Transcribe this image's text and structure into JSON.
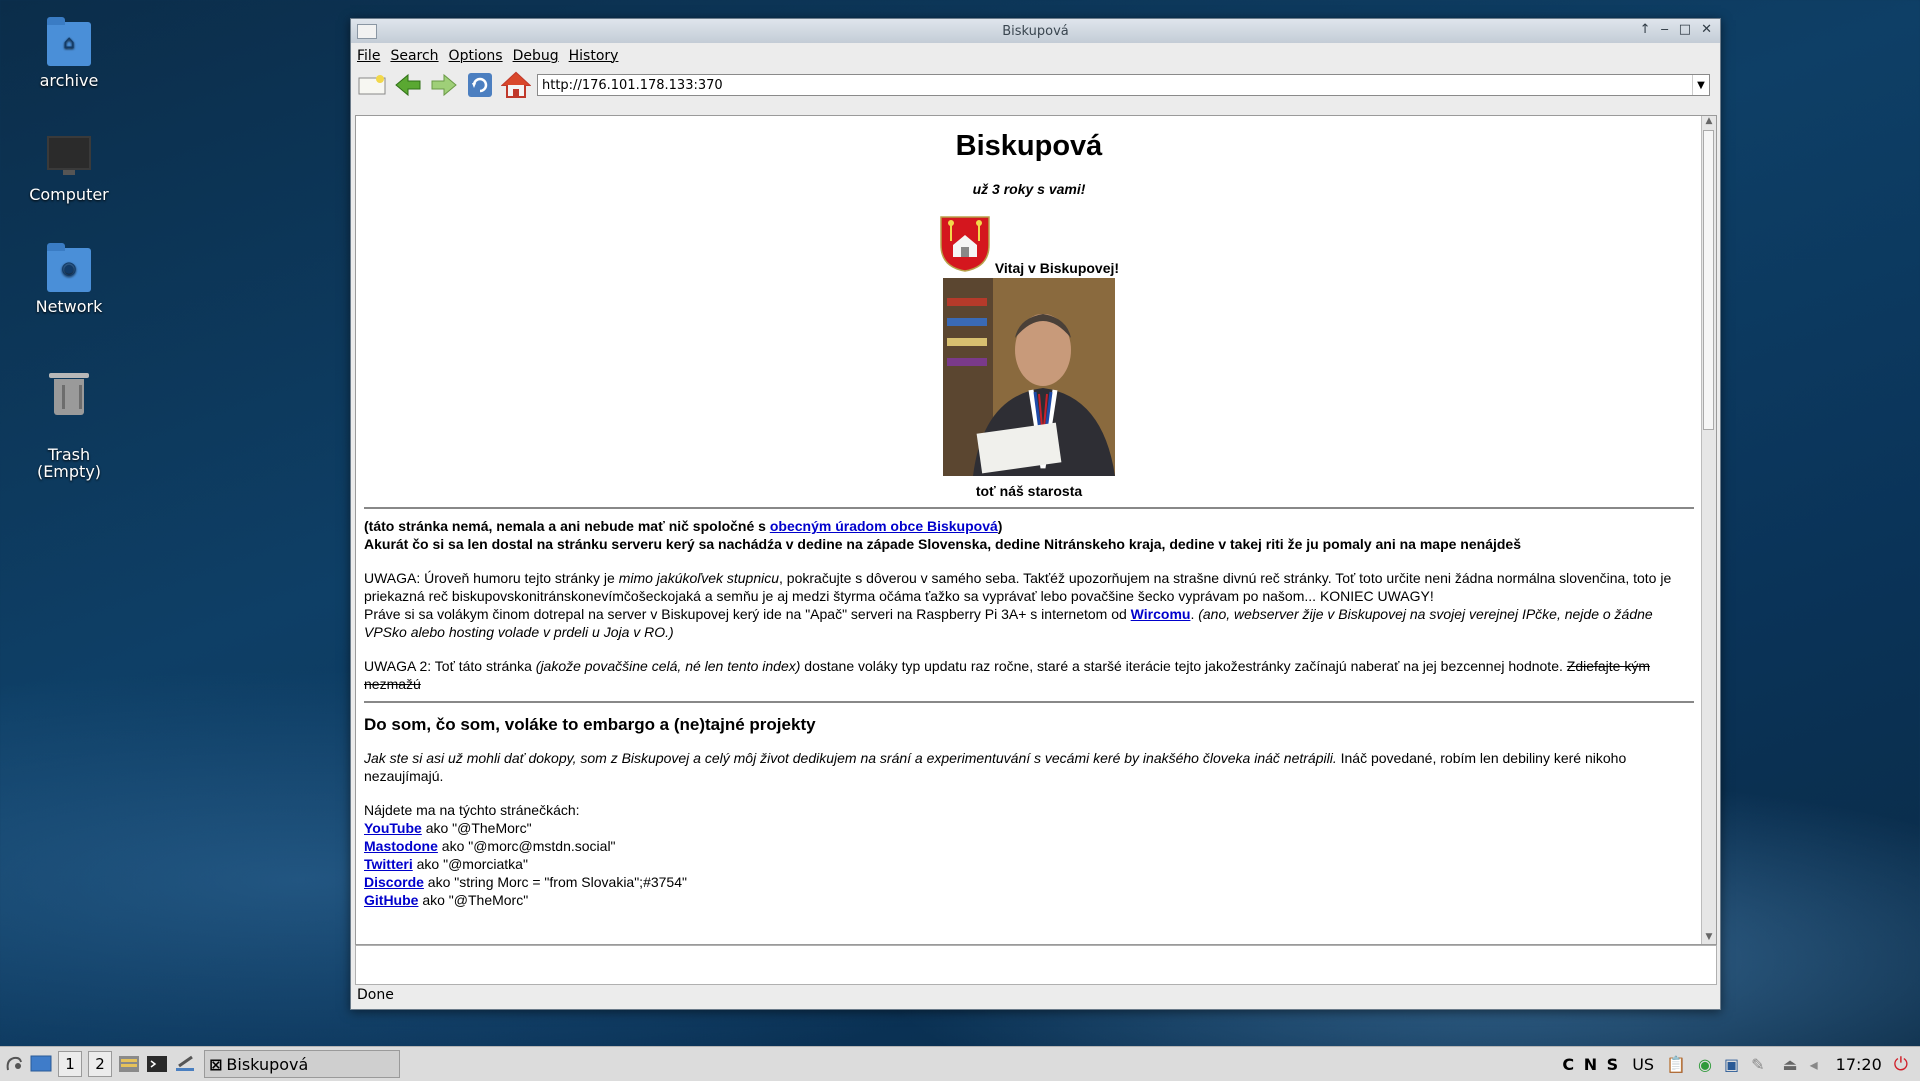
{
  "desktop": {
    "icons": [
      {
        "label": "archive",
        "icon": "home-folder-icon"
      },
      {
        "label": "Computer",
        "icon": "computer-icon"
      },
      {
        "label": "Network",
        "icon": "network-folder-icon"
      },
      {
        "label": "Trash\n(Empty)",
        "icon": "trash-icon"
      }
    ]
  },
  "window": {
    "title": "Biskupová",
    "menu": [
      "File",
      "Search",
      "Options",
      "Debug",
      "History"
    ],
    "url": "http://176.101.178.133:370",
    "status": "Done"
  },
  "page": {
    "heading": "Biskupová",
    "tagline": "už 3 roky s vami!",
    "welcome": "Vitaj v Biskupovej!",
    "photo_caption": "toť náš starosta",
    "disclaimer_pre": "(táto stránka nemá, nemala a ani nebude mať nič spoločné s ",
    "disclaimer_link": "obecným úradom obce Biskupová",
    "disclaimer_post": ")",
    "intro_bold": "Akurát čo si sa len dostal na stránku serveru kerý sa nachádźa v dedine na západe Slovenska, dedine Nitránskeho kraja, dedine v takej riti že ju pomaly ani na mape nenájdeš",
    "uwaga1_pre": "UWAGA: Úroveň humoru tejto stránky je ",
    "uwaga1_italic": "mimo jakúkoľvek stupnicu",
    "uwaga1_post": ", pokračujte s dôverou v samého seba. Takťéž upozorňujem na strašne divnú reč stránky. Toť toto určite neni žádna normálna slovenčina, toto je priekazná reč biskupovskonitránskonevímčošeckojaká a semňu je aj medzi štyrma očáma ťažko sa vyprávať lebo povačšine šecko vyprávam po našom... KONIEC UWAGY!",
    "server_pre": "Práve si sa volákym činom dotrepal na server v Biskupovej kerý ide na \"Apač\" serveri na Raspberry Pi 3A+ s internetom od ",
    "server_link": "Wircomu",
    "server_post": ". ",
    "server_italic": "(ano, webserver žije v Biskupovej na svojej verejnej IPčke, nejde o žádne VPSko alebo hosting volade v prdeli u Joja v RO.)",
    "uwaga2_pre": "UWAGA 2: Toť táto stránka ",
    "uwaga2_italic": "(jakože povačšine celá, né len tento index)",
    "uwaga2_post": " dostane voláky typ updatu raz ročne, staré a staršé iterácie tejto jakožestránky začínajú naberať na jej bezcennej hodnote. ",
    "uwaga2_strike": "Zdiefajte kým nezmažú",
    "section_title": "Do som, čo som, voláke to embargo a (ne)tajné projekty",
    "about_italic": "Jak ste si asi už mohli dať dokopy, som z Biskupovej a celý môj život dedikujem na srání a experimentuvání s vecámi keré by inakšého človeka ináč netrápili.",
    "about_post": " Ináč povedané, robím len debiliny keré nikoho nezaujímajú.",
    "find_me": "Nájdete ma na týchto stránečkách:",
    "links": [
      {
        "name": "YouTube",
        "handle": " ako \"@TheMorc\""
      },
      {
        "name": "Mastodone",
        "handle": " ako \"@morc@mstdn.social\""
      },
      {
        "name": "Twitteri",
        "handle": " ako \"@morciatka\""
      },
      {
        "name": "Discorde",
        "handle": " ako \"string Morc = \"from Slovakia\";#3754\""
      },
      {
        "name": "GitHube",
        "handle": " ako \"@TheMorc\""
      }
    ]
  },
  "taskbar": {
    "workspaces": [
      "1",
      "2"
    ],
    "task_title": "Biskupová",
    "indicators": "C N S",
    "keyboard": "US",
    "clock": "17:20"
  }
}
